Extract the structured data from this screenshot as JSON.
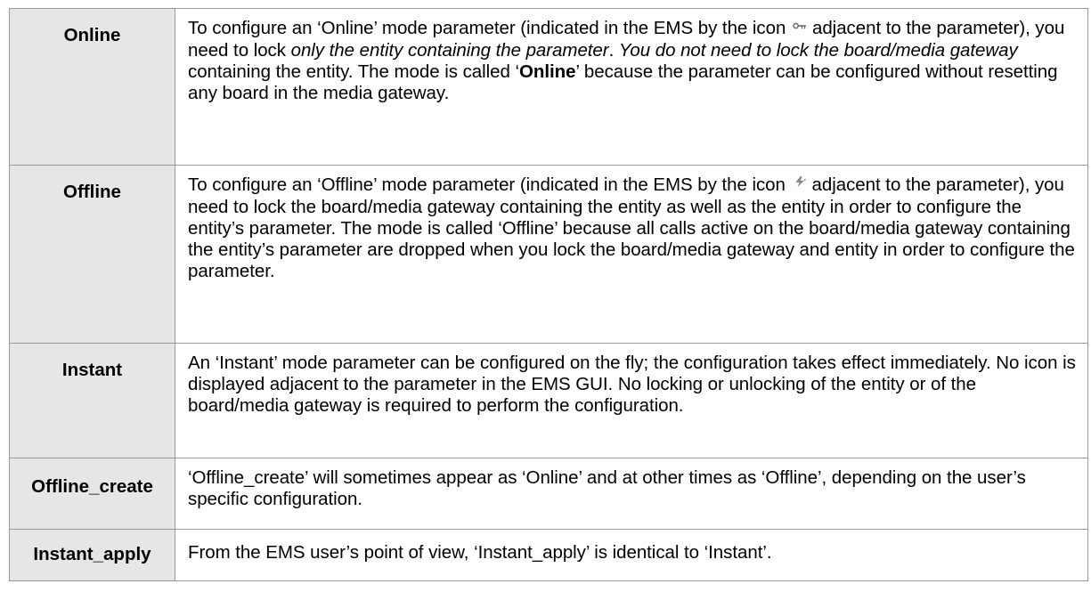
{
  "caption": "",
  "rows": [
    {
      "mode": "Online",
      "icon": "online-key-icon",
      "desc": {
        "a": "To configure an ‘Online’ mode parameter (indicated in the EMS by the icon",
        "b": "adjacent to the parameter), you need to lock ",
        "c": "only the entity containing the parameter",
        "d": ". ",
        "e": "You do not need to lock the board/media gateway",
        "f": " containing the entity. The mode is called ‘",
        "g": "Online",
        "h": "’ because the parameter can be configured without resetting any board in the media gateway."
      }
    },
    {
      "mode": "Offline",
      "icon": "offline-lightning-icon",
      "desc": {
        "a": "To configure an ‘Offline’ mode parameter (indicated in the EMS by the icon",
        "b": "adjacent to the parameter), you need to lock the board/media gateway containing the entity as well as the entity in order to configure the entity’s parameter. The mode is called ‘Offline’ because all calls active on the board/media gateway containing the entity’s parameter are dropped when you lock the board/media gateway and entity in order to configure the parameter."
      }
    },
    {
      "mode": "Instant",
      "desc": "An ‘Instant’ mode parameter can be configured on the fly; the configuration takes effect immediately. No icon is displayed adjacent to the parameter in the EMS GUI. No locking or unlocking of the entity or of the board/media gateway is required to perform the configuration."
    },
    {
      "mode": "Offline_create",
      "desc": "‘Offline_create’ will sometimes appear as ‘Online’ and at other times as ‘Offline’, depending on the user’s specific configuration."
    },
    {
      "mode": "Instant_apply",
      "desc": "From the EMS user’s point of view, ‘Instant_apply’ is identical to ‘Instant’."
    }
  ]
}
